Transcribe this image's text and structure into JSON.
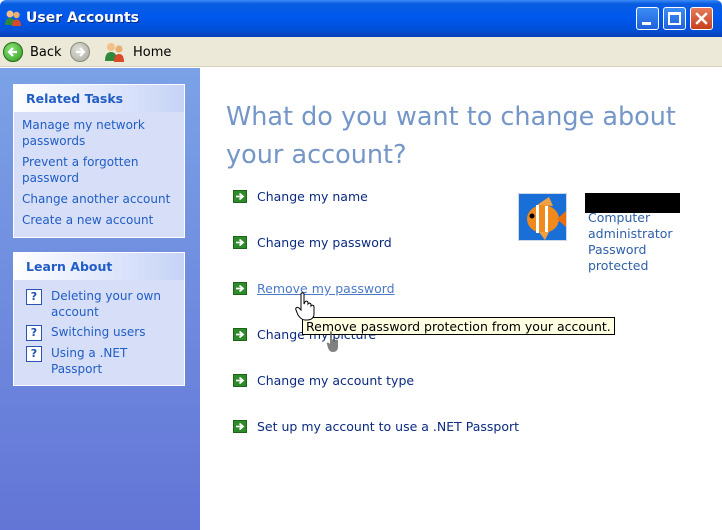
{
  "window": {
    "title": "User Accounts",
    "app_icon": "users-icon"
  },
  "toolbar": {
    "back_label": "Back",
    "back_icon": "back-arrow-icon",
    "forward_icon": "forward-arrow-icon",
    "home_label": "Home",
    "home_icon": "users-home-icon"
  },
  "related_tasks": {
    "header": "Related Tasks",
    "items": [
      {
        "label": "Manage my network passwords"
      },
      {
        "label": "Prevent a forgotten password"
      },
      {
        "label": "Change another account"
      },
      {
        "label": "Create a new account"
      }
    ]
  },
  "learn_about": {
    "header": "Learn About",
    "icon": "help-icon",
    "items": [
      {
        "label": "Deleting your own account"
      },
      {
        "label": "Switching users"
      },
      {
        "label": "Using a .NET Passport"
      }
    ]
  },
  "main": {
    "heading": "What do you want to change about your account?",
    "actions": [
      {
        "label": "Change my name"
      },
      {
        "label": "Change my password"
      },
      {
        "label": "Remove my password"
      },
      {
        "label": "Change my picture"
      },
      {
        "label": "Change my account type"
      },
      {
        "label": "Set up my account to use a .NET Passport"
      }
    ],
    "hovered_action": "Remove my password"
  },
  "account": {
    "picture": "fish-picture",
    "type": "Computer administrator",
    "status": "Password protected"
  },
  "tooltip": "Remove password protection from your account.",
  "colors": {
    "titlebar": "#0058ee",
    "left_pane": "#6f8de0",
    "heading": "#7496c8",
    "link": "#215dc6",
    "arrow": "#2f8a2c"
  }
}
